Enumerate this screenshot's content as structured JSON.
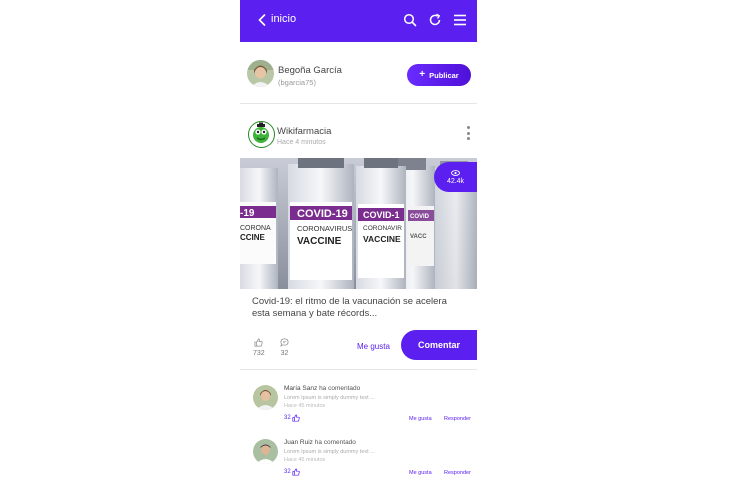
{
  "header": {
    "title": "inicio",
    "background": "#5b20f0"
  },
  "profile": {
    "name": "Begoña García",
    "handle": "(bgarcia75)",
    "publish_label": "Publicar"
  },
  "post": {
    "author": "Wikifarmacia",
    "time": "Hace 4 minutos",
    "views": "42.4k",
    "caption": "Covid-19: el ritmo de la vacunación se acelera esta semana y bate récords...",
    "image": {
      "label_top": "COVID-19",
      "label_mid": "CORONAVIRUS",
      "label_bot": "VACCINE"
    },
    "likes": "732",
    "comments": "32",
    "like_label": "Me gusta",
    "comment_label": "Comentar"
  },
  "comments": [
    {
      "name": "María Sanz",
      "action": "ha comentado",
      "text": "Lorem Ipsum is simply dummy text ...",
      "time": "Hace 45 minutos",
      "count": "32",
      "like_label": "Me gusta",
      "reply_label": "Responder"
    },
    {
      "name": "Juan Ruiz",
      "action": "ha comentado",
      "text": "Lorem Ipsum is simply dummy text ...",
      "time": "Hace 45 minutos",
      "count": "32",
      "like_label": "Me gusta",
      "reply_label": "Responder"
    }
  ],
  "icons": [
    "back-chevron-icon",
    "search-icon",
    "refresh-icon",
    "menu-icon",
    "plus-icon",
    "eye-icon",
    "thumbs-up-icon",
    "comment-bubble-icon",
    "kebab-icon"
  ]
}
